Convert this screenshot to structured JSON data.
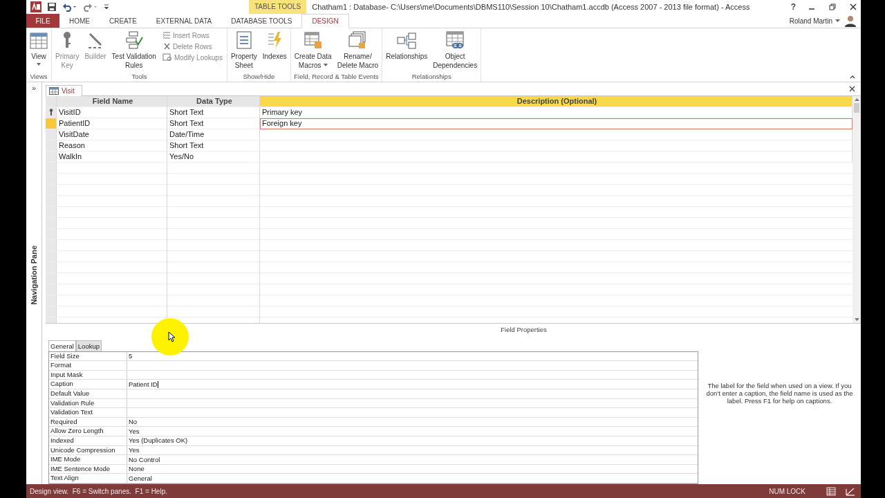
{
  "title_bar": {
    "context_label": "TABLE TOOLS",
    "title": "Chatham1 : Database- C:\\Users\\me\\Documents\\DBMS110\\Session 10\\Chatham1.accdb (Access 2007 - 2013 file format) - Access",
    "help": "?"
  },
  "tabs": [
    {
      "label": "FILE",
      "kind": "file",
      "selected": false
    },
    {
      "label": "HOME",
      "kind": "normal",
      "selected": false
    },
    {
      "label": "CREATE",
      "kind": "normal",
      "selected": false
    },
    {
      "label": "EXTERNAL DATA",
      "kind": "normal",
      "selected": false
    },
    {
      "label": "DATABASE TOOLS",
      "kind": "normal",
      "selected": false
    },
    {
      "label": "DESIGN",
      "kind": "context",
      "selected": true
    }
  ],
  "user": {
    "name": "Roland Martin"
  },
  "ribbon": [
    {
      "label": "Views",
      "items": [
        {
          "kind": "large",
          "label": "View",
          "dropdown": true,
          "disabled": false
        }
      ]
    },
    {
      "label": "Tools",
      "items": [
        {
          "kind": "large",
          "label": "Primary\nKey",
          "dropdown": false,
          "disabled": true
        },
        {
          "kind": "large",
          "label": "Builder",
          "dropdown": false,
          "disabled": true
        },
        {
          "kind": "large",
          "label": "Test Validation\nRules",
          "dropdown": false,
          "disabled": false
        },
        {
          "kind": "small",
          "label": "Insert Rows",
          "disabled": true
        },
        {
          "kind": "small",
          "label": "Delete Rows",
          "disabled": true
        },
        {
          "kind": "small",
          "label": "Modify Lookups",
          "disabled": true
        }
      ]
    },
    {
      "label": "Show/Hide",
      "items": [
        {
          "kind": "large",
          "label": "Property\nSheet",
          "dropdown": false,
          "disabled": false
        },
        {
          "kind": "large",
          "label": "Indexes",
          "dropdown": false,
          "disabled": false
        }
      ]
    },
    {
      "label": "Field, Record & Table Events",
      "items": [
        {
          "kind": "large",
          "label": "Create Data\nMacros",
          "dropdown": true,
          "disabled": false
        },
        {
          "kind": "large",
          "label": "Rename/\nDelete Macro",
          "dropdown": false,
          "disabled": false
        }
      ]
    },
    {
      "label": "Relationships",
      "items": [
        {
          "kind": "large",
          "label": "Relationships",
          "dropdown": false,
          "disabled": false
        },
        {
          "kind": "large",
          "label": "Object\nDependencies",
          "dropdown": false,
          "disabled": false
        }
      ]
    }
  ],
  "nav_pane": {
    "toggle": "»",
    "label": "Navigation Pane"
  },
  "document_tab": {
    "label": "Visit"
  },
  "table": {
    "columns": [
      "Field Name",
      "Data Type",
      "Description (Optional)"
    ],
    "rows": [
      {
        "field_name": "VisitID",
        "data_type": "Short Text",
        "description": "Primary key",
        "primary_key": true,
        "selected": false
      },
      {
        "field_name": "PatientID",
        "data_type": "Short Text",
        "description": "Foreign key",
        "primary_key": false,
        "selected": true
      },
      {
        "field_name": "VisitDate",
        "data_type": "Date/Time",
        "primary_key": false,
        "selected": false
      },
      {
        "field_name": "Reason",
        "data_type": "Short Text",
        "primary_key": false,
        "selected": false
      },
      {
        "field_name": "WalkIn",
        "data_type": "Yes/No",
        "primary_key": false,
        "selected": false
      }
    ]
  },
  "field_properties": {
    "title": "Field Properties",
    "tabs": [
      {
        "label": "General",
        "selected": true
      },
      {
        "label": "Lookup",
        "selected": false
      }
    ],
    "rows": [
      {
        "name": "Field Size",
        "value": "5",
        "editing": false
      },
      {
        "name": "Format"
      },
      {
        "name": "Input Mask"
      },
      {
        "name": "Caption",
        "value": "Patient ID",
        "editing": true
      },
      {
        "name": "Default Value"
      },
      {
        "name": "Validation Rule"
      },
      {
        "name": "Validation Text"
      },
      {
        "name": "Required",
        "value": "No",
        "editing": false
      },
      {
        "name": "Allow Zero Length",
        "value": "Yes",
        "editing": false
      },
      {
        "name": "Indexed",
        "value": "Yes (Duplicates OK)",
        "editing": false
      },
      {
        "name": "Unicode Compression",
        "value": "Yes",
        "editing": false
      },
      {
        "name": "IME Mode",
        "value": "No Control",
        "editing": false
      },
      {
        "name": "IME Sentence Mode",
        "value": "None",
        "editing": false
      },
      {
        "name": "Text Align",
        "value": "General",
        "editing": false
      }
    ],
    "help": "The label for the field when used on a view. If you don't enter a caption, the field name is used as the label. Press F1 for help on captions."
  },
  "status_bar": {
    "message": "Design view.  F6 = Switch panes.  F1 = Help.",
    "num_lock": "NUM LOCK"
  }
}
